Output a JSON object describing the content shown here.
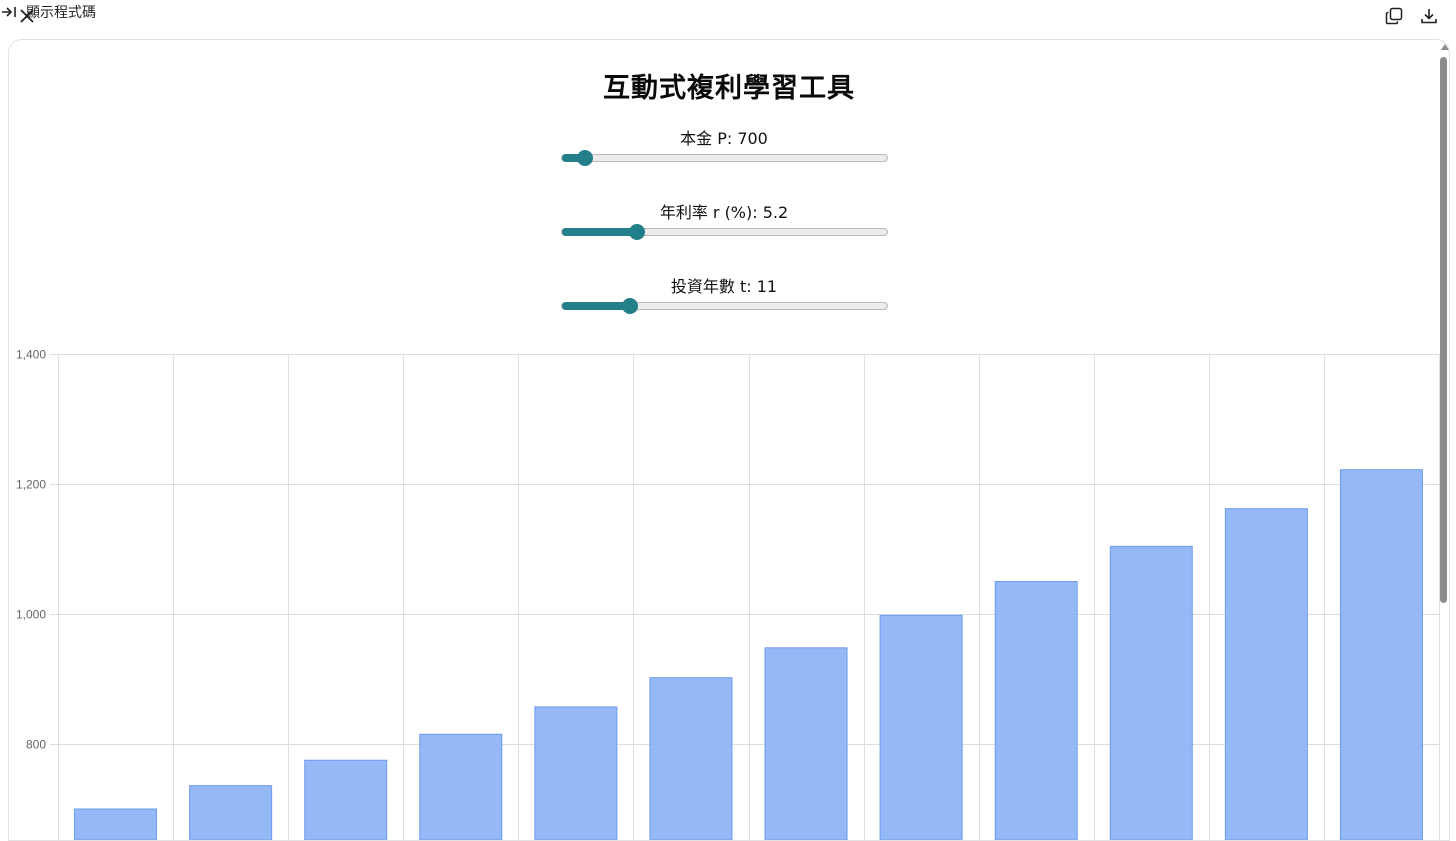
{
  "topbar": {
    "show_code_label": "顯示程式碼"
  },
  "app": {
    "title": "互動式複利學習工具"
  },
  "controls": [
    {
      "label": "本金 P: 700",
      "fraction": 0.07
    },
    {
      "label": "年利率 r (%): 5.2",
      "fraction": 0.23
    },
    {
      "label": "投資年數 t: 11",
      "fraction": 0.21
    }
  ],
  "chart_data": {
    "type": "bar",
    "categories": [
      "",
      "",
      "",
      "",
      "",
      "",
      "",
      "",
      "",
      "",
      "",
      ""
    ],
    "values": [
      700,
      736,
      775,
      815,
      857,
      902,
      948,
      998,
      1050,
      1104,
      1162,
      1222
    ],
    "ylim": [
      700,
      1400
    ],
    "yticks": [
      "800",
      "1,000",
      "1,200",
      "1,400"
    ],
    "grid": true,
    "bar_color": "#8fb4f6",
    "bar_border": "#6e9bee"
  },
  "colors": {
    "accent": "#237f8a",
    "bar": "#8fb4f6"
  }
}
